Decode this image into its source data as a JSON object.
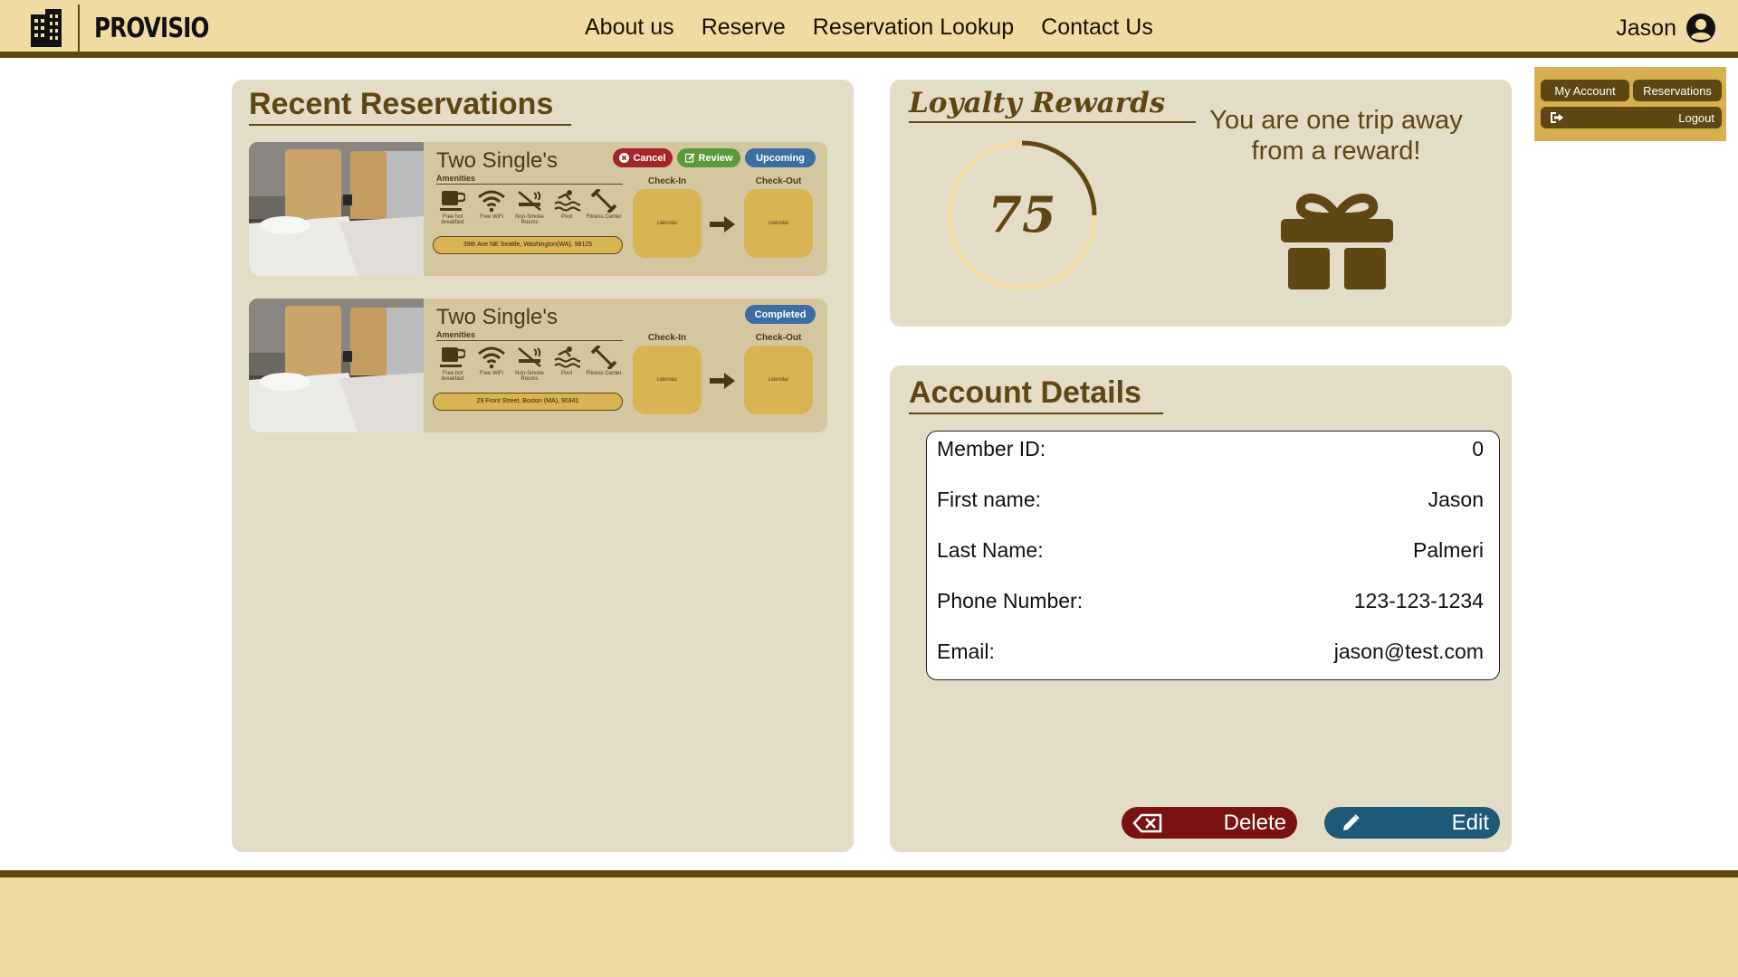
{
  "header": {
    "brand": "PROVISIO",
    "nav": [
      "About us",
      "Reserve",
      "Reservation Lookup",
      "Contact Us"
    ],
    "user_name": "Jason"
  },
  "account_menu": {
    "my_account": "My Account",
    "reservations": "Reservations",
    "logout": "Logout"
  },
  "recent": {
    "title": "Recent Reservations",
    "amenities_label": "Amenities",
    "amenities": [
      "Free hot breakfast",
      "Free WiFi",
      "Non-Smoke Rooms",
      "Pool",
      "Fitness Center"
    ],
    "checkin_label": "Check-In",
    "checkout_label": "Check-Out",
    "calendar_placeholder": "calendar",
    "reservations": [
      {
        "room": "Two Single's",
        "address": "39th Ave NE Seattle, Washington(WA), 98125",
        "cancel": "Cancel",
        "review": "Review",
        "status": "Upcoming"
      },
      {
        "room": "Two Single's",
        "address": "29 Front Street, Boston (MA), 90341",
        "status": "Completed"
      }
    ]
  },
  "loyalty": {
    "title": "Loyalty Rewards",
    "points": "75",
    "progress": 0.25,
    "message": "You are one trip away from a reward!"
  },
  "account": {
    "title": "Account Details",
    "fields": [
      {
        "label": "Member ID:",
        "value": "0"
      },
      {
        "label": "First name:",
        "value": "Jason"
      },
      {
        "label": "Last Name:",
        "value": "Palmeri"
      },
      {
        "label": "Phone Number:",
        "value": "123-123-1234"
      },
      {
        "label": "Email:",
        "value": "jason@test.com"
      }
    ],
    "delete_label": "Delete",
    "edit_label": "Edit"
  },
  "colors": {
    "brand_dark": "#5e4712",
    "header_bg": "#f0dca2",
    "panel_bg": "#e3dcc6",
    "gold": "#d8b452",
    "delete": "#7a1212",
    "edit": "#1c5a78"
  }
}
